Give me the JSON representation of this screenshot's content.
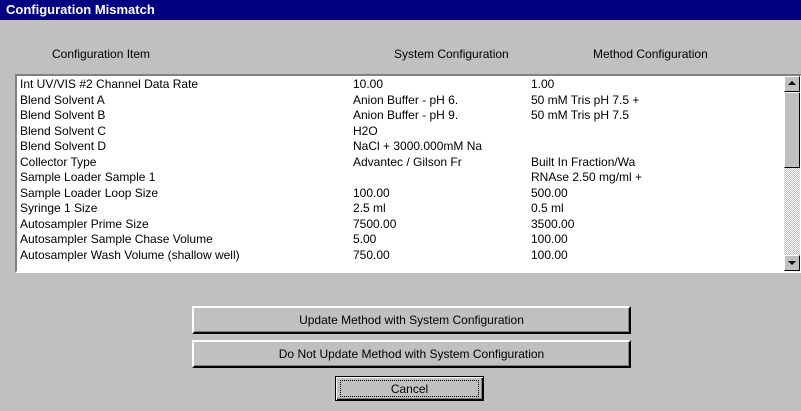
{
  "window": {
    "title": "Configuration Mismatch"
  },
  "columns": {
    "item": "Configuration Item",
    "system": "System Configuration",
    "method": "Method Configuration"
  },
  "rows": [
    {
      "item": "Int UV/VIS #2 Channel Data Rate",
      "system": "10.00",
      "method": "1.00"
    },
    {
      "item": "Blend Solvent A",
      "system": "Anion Buffer - pH 6.",
      "method": "50 mM Tris pH 7.5 +"
    },
    {
      "item": "Blend Solvent B",
      "system": "Anion Buffer - pH 9.",
      "method": "50 mM Tris pH 7.5"
    },
    {
      "item": "Blend Solvent C",
      "system": "H2O",
      "method": ""
    },
    {
      "item": "Blend Solvent D",
      "system": "NaCl + 3000.000mM Na",
      "method": ""
    },
    {
      "item": "Collector Type",
      "system": "Advantec / Gilson Fr",
      "method": "Built In Fraction/Wa"
    },
    {
      "item": "Sample Loader Sample 1",
      "system": "",
      "method": "RNAse 2.50 mg/ml  +"
    },
    {
      "item": "Sample Loader Loop Size",
      "system": "100.00",
      "method": "500.00"
    },
    {
      "item": "Syringe 1 Size",
      "system": "2.5 ml",
      "method": "0.5 ml"
    },
    {
      "item": "Autosampler Prime Size",
      "system": "7500.00",
      "method": "3500.00"
    },
    {
      "item": "Autosampler Sample Chase Volume",
      "system": "5.00",
      "method": "100.00"
    },
    {
      "item": "Autosampler Wash Volume (shallow well)",
      "system": "750.00",
      "method": "100.00"
    }
  ],
  "buttons": {
    "update": "Update Method with System Configuration",
    "no_update": "Do Not Update Method with System Configuration",
    "cancel": "Cancel"
  }
}
